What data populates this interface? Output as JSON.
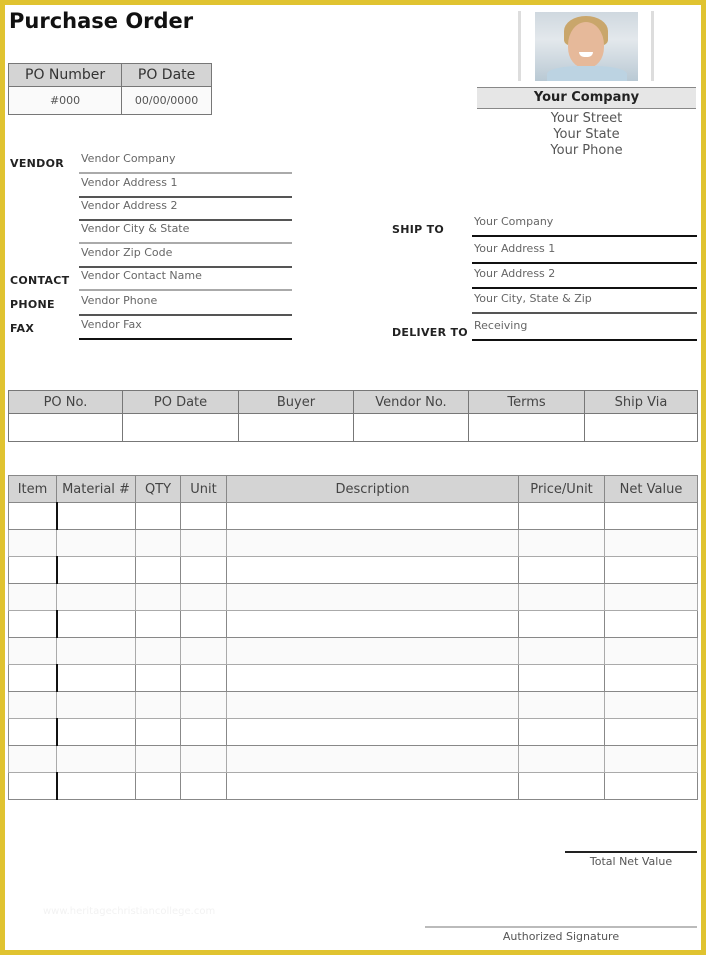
{
  "document": {
    "title": "Purchase Order",
    "border_color": "#e0c330"
  },
  "po_header": {
    "columns": [
      "PO Number",
      "PO Date"
    ],
    "values": [
      "#000",
      "00/00/0000"
    ]
  },
  "company": {
    "photo_icon": "company-photo",
    "name": "Your Company",
    "street": "Your Street",
    "state": "Your State",
    "phone": "Your Phone"
  },
  "vendor": {
    "labels": {
      "vendor": "VENDOR",
      "contact": "CONTACT",
      "phone": "PHONE",
      "fax": "FAX"
    },
    "fields": {
      "company": "Vendor Company",
      "address1": "Vendor Address 1",
      "address2": "Vendor Address 2",
      "city_state": "Vendor City & State",
      "zip": "Vendor Zip Code",
      "contact_name": "Vendor Contact Name",
      "phone": "Vendor Phone",
      "fax": "Vendor Fax"
    }
  },
  "ship_to": {
    "labels": {
      "ship_to": "SHIP TO",
      "deliver_to": "DELIVER TO"
    },
    "fields": {
      "company": "Your Company",
      "address1": "Your Address 1",
      "address2": "Your Address 2",
      "city_state_zip": "Your City, State & Zip",
      "deliver_to": "Receiving"
    }
  },
  "order_info": {
    "columns": [
      "PO No.",
      "PO Date",
      "Buyer",
      "Vendor No.",
      "Terms",
      "Ship Via"
    ],
    "values": [
      "",
      "",
      "",
      "",
      "",
      ""
    ]
  },
  "line_items": {
    "columns": [
      "Item",
      "Material #",
      "QTY",
      "Unit",
      "Description",
      "Price/Unit",
      "Net Value"
    ],
    "rows": [
      [
        "",
        "",
        "",
        "",
        "",
        "",
        ""
      ],
      [
        "",
        "",
        "",
        "",
        "",
        "",
        ""
      ],
      [
        "",
        "",
        "",
        "",
        "",
        "",
        ""
      ],
      [
        "",
        "",
        "",
        "",
        "",
        "",
        ""
      ],
      [
        "",
        "",
        "",
        "",
        "",
        "",
        ""
      ],
      [
        "",
        "",
        "",
        "",
        "",
        "",
        ""
      ],
      [
        "",
        "",
        "",
        "",
        "",
        "",
        ""
      ],
      [
        "",
        "",
        "",
        "",
        "",
        "",
        ""
      ],
      [
        "",
        "",
        "",
        "",
        "",
        "",
        ""
      ],
      [
        "",
        "",
        "",
        "",
        "",
        "",
        ""
      ],
      [
        "",
        "",
        "",
        "",
        "",
        "",
        ""
      ]
    ]
  },
  "footer": {
    "total_label": "Total Net Value",
    "total_value": "",
    "signature_label": "Authorized Signature",
    "watermark": "www.heritagechristiancollege.com"
  }
}
